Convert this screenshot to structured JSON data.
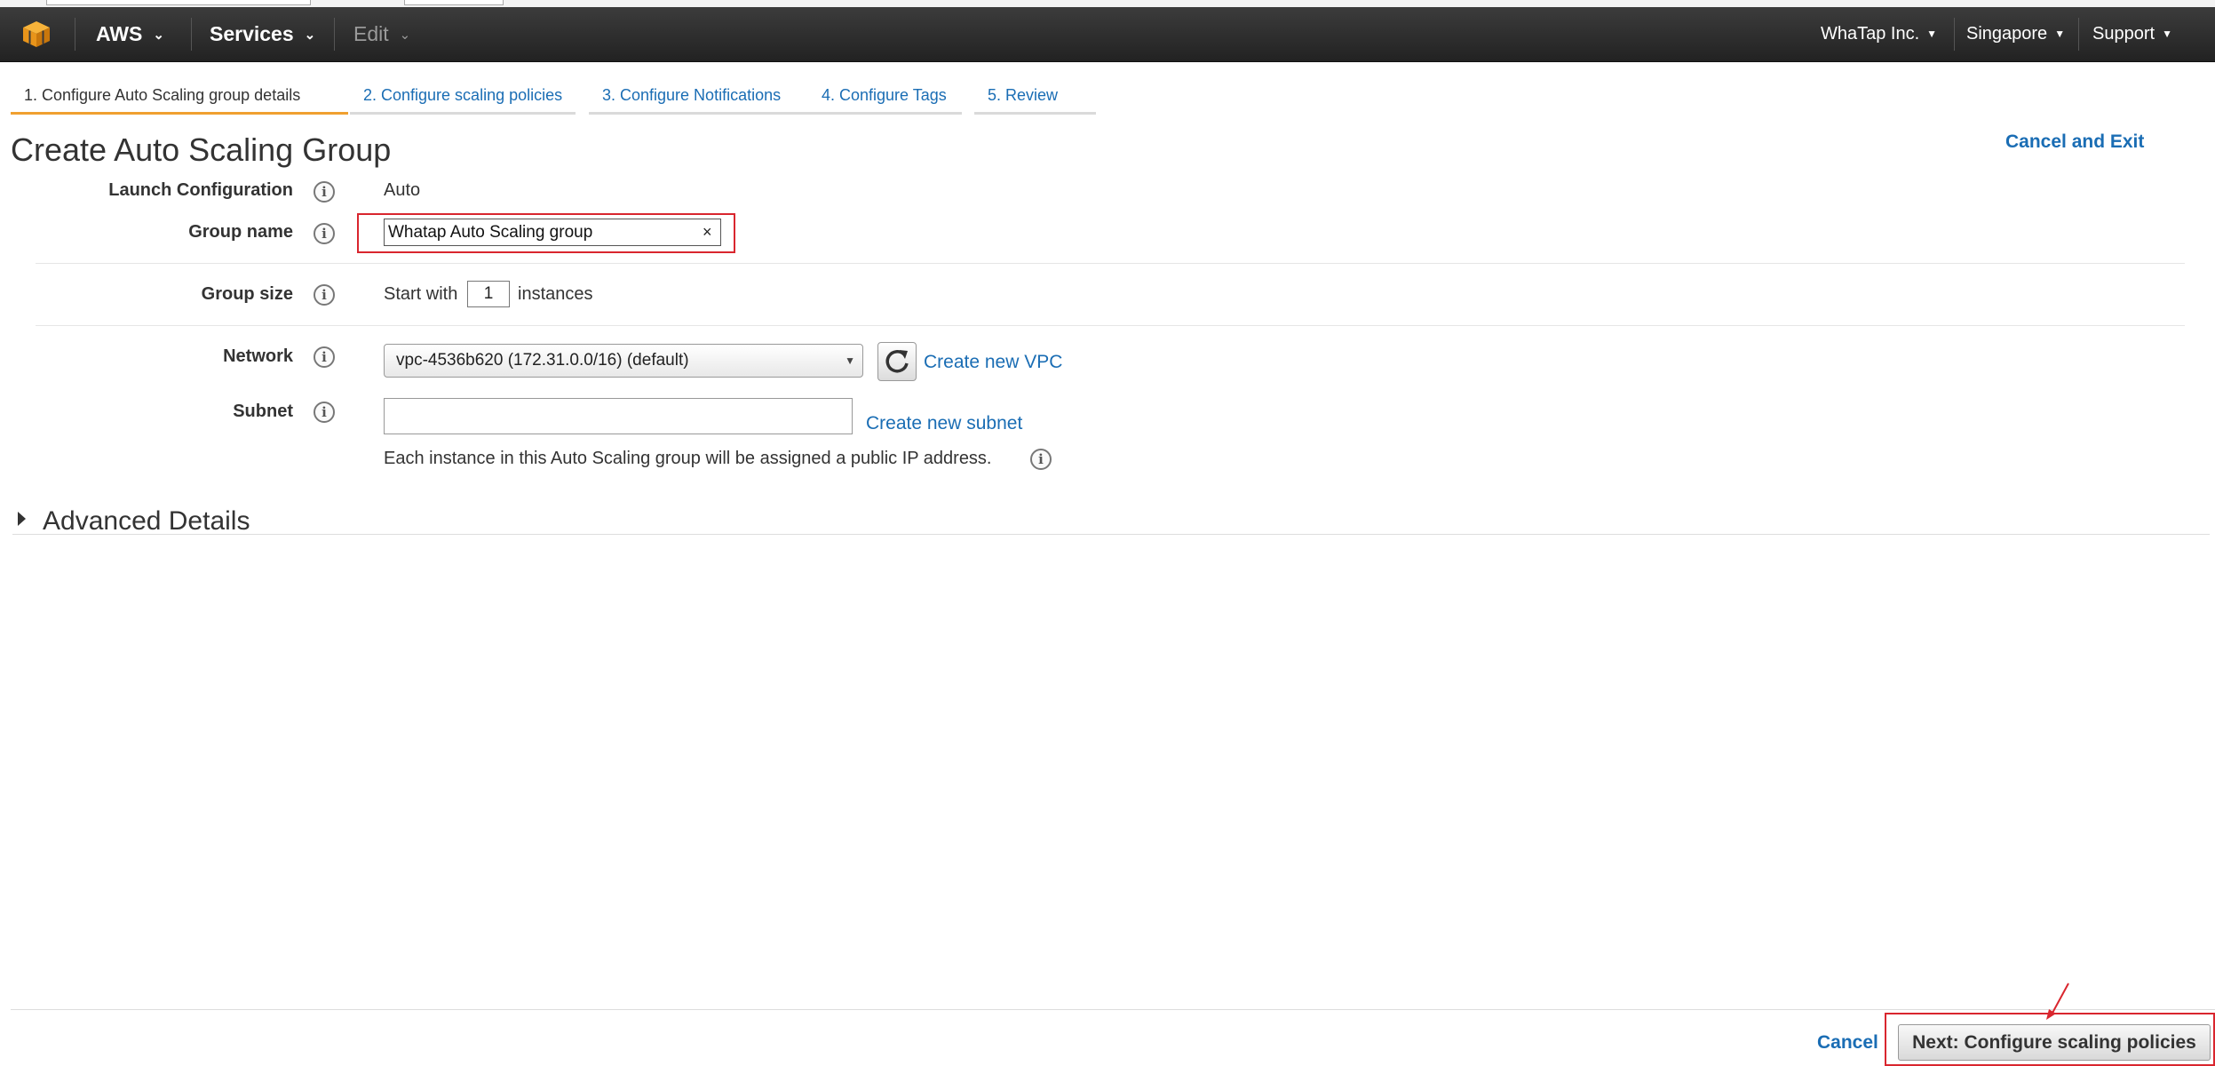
{
  "navbar": {
    "brand": "AWS",
    "services": "Services",
    "edit": "Edit",
    "account": "WhaTap Inc.",
    "region": "Singapore",
    "support": "Support"
  },
  "tabs": [
    {
      "label": "1. Configure Auto Scaling group details",
      "active": true
    },
    {
      "label": "2. Configure scaling policies",
      "active": false
    },
    {
      "label": "3. Configure Notifications",
      "active": false
    },
    {
      "label": "4. Configure Tags",
      "active": false
    },
    {
      "label": "5. Review",
      "active": false
    }
  ],
  "page": {
    "title": "Create Auto Scaling Group",
    "cancel_and_exit": "Cancel and Exit"
  },
  "form": {
    "launch_configuration": {
      "label": "Launch Configuration",
      "value": "Auto"
    },
    "group_name": {
      "label": "Group name",
      "value": "Whatap Auto Scaling group"
    },
    "group_size": {
      "label": "Group size",
      "prefix": "Start with",
      "value": "1",
      "suffix": "instances"
    },
    "network": {
      "label": "Network",
      "selected": "vpc-4536b620 (172.31.0.0/16) (default)",
      "create_link": "Create new VPC"
    },
    "subnet": {
      "label": "Subnet",
      "value": "",
      "create_link": "Create new subnet"
    },
    "public_ip_note": "Each instance in this Auto Scaling group will be assigned a public IP address."
  },
  "advanced": {
    "title": "Advanced Details"
  },
  "footer": {
    "cancel": "Cancel",
    "next": "Next: Configure scaling policies"
  },
  "colors": {
    "navbar": "#232323",
    "link": "#1a6db4",
    "active_tab_underline": "#f0a030",
    "highlight_box": "#d9262e",
    "aws_logo": "#f7a41d"
  }
}
